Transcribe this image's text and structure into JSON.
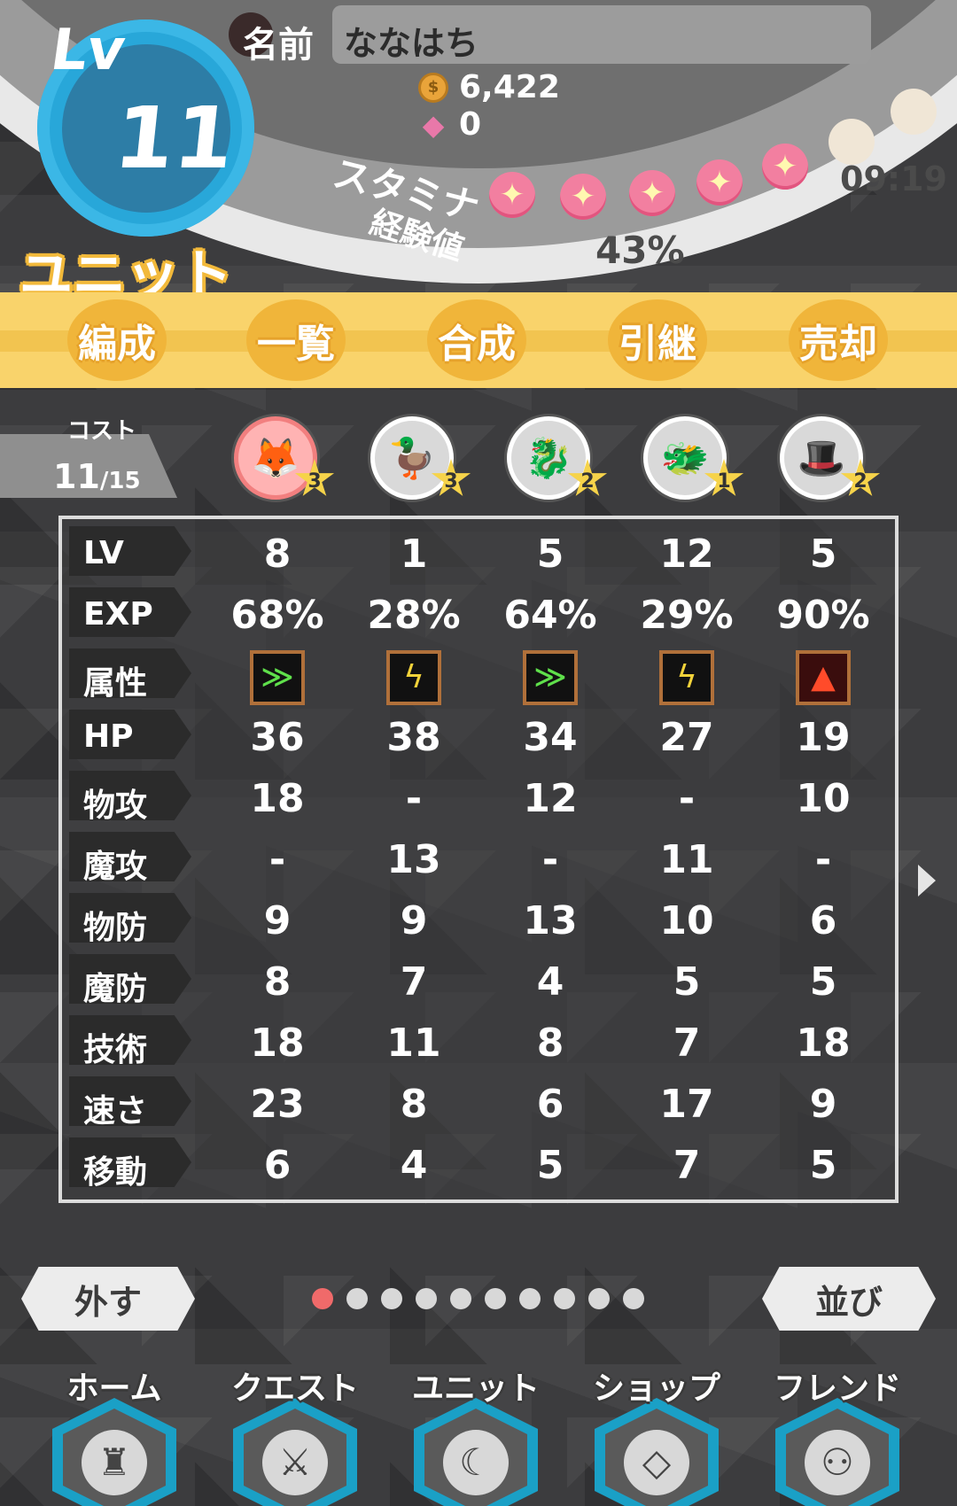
{
  "header": {
    "level_label": "Lv",
    "level_value": "11",
    "name_label": "名前",
    "name_value": "ななはち",
    "coins": "6,422",
    "gems": "0",
    "stamina_label": "スタミナ",
    "stamina_filled": 5,
    "stamina_total": 7,
    "stamina_timer": "09:19",
    "exp_label": "経験値",
    "exp_percent": "43%",
    "screen_title": "ユニット"
  },
  "tabs": [
    {
      "label": "編成"
    },
    {
      "label": "一覧"
    },
    {
      "label": "合成"
    },
    {
      "label": "引継"
    },
    {
      "label": "売却"
    }
  ],
  "cost": {
    "label": "コスト",
    "current": "11",
    "max": "/15"
  },
  "units": [
    {
      "icon": "fox-girl-unit-icon",
      "stars": "3",
      "selected": true
    },
    {
      "icon": "duck-unit-icon",
      "stars": "3",
      "selected": false
    },
    {
      "icon": "pink-dragon-unit-icon",
      "stars": "2",
      "selected": false
    },
    {
      "icon": "orange-dragon-unit-icon",
      "stars": "1",
      "selected": false
    },
    {
      "icon": "wizard-hat-unit-icon",
      "stars": "2",
      "selected": false
    }
  ],
  "stats": {
    "labels": [
      "LV",
      "EXP",
      "属性",
      "HP",
      "物攻",
      "魔攻",
      "物防",
      "魔防",
      "技術",
      "速さ",
      "移動"
    ],
    "lv": [
      "8",
      "1",
      "5",
      "12",
      "5"
    ],
    "exp": [
      "68%",
      "28%",
      "64%",
      "29%",
      "90%"
    ],
    "attributes": [
      "wind",
      "thunder",
      "wind",
      "thunder",
      "fire"
    ],
    "hp": [
      "36",
      "38",
      "34",
      "27",
      "19"
    ],
    "patk": [
      "18",
      "-",
      "12",
      "-",
      "10"
    ],
    "matk": [
      "-",
      "13",
      "-",
      "11",
      "-"
    ],
    "pdef": [
      "9",
      "9",
      "13",
      "10",
      "6"
    ],
    "mdef": [
      "8",
      "7",
      "4",
      "5",
      "5"
    ],
    "skill": [
      "18",
      "11",
      "8",
      "7",
      "18"
    ],
    "speed": [
      "23",
      "8",
      "6",
      "17",
      "9"
    ],
    "move": [
      "6",
      "4",
      "5",
      "7",
      "5"
    ]
  },
  "controls": {
    "remove_label": "外す",
    "sort_label": "並び",
    "page_count": 10,
    "active_page": 1
  },
  "nav": [
    {
      "label": "ホーム",
      "icon": "castle-icon"
    },
    {
      "label": "クエスト",
      "icon": "crossed-swords-icon"
    },
    {
      "label": "ユニット",
      "icon": "witch-moon-icon"
    },
    {
      "label": "ショップ",
      "icon": "gems-icon"
    },
    {
      "label": "フレンド",
      "icon": "friends-icon"
    }
  ]
}
